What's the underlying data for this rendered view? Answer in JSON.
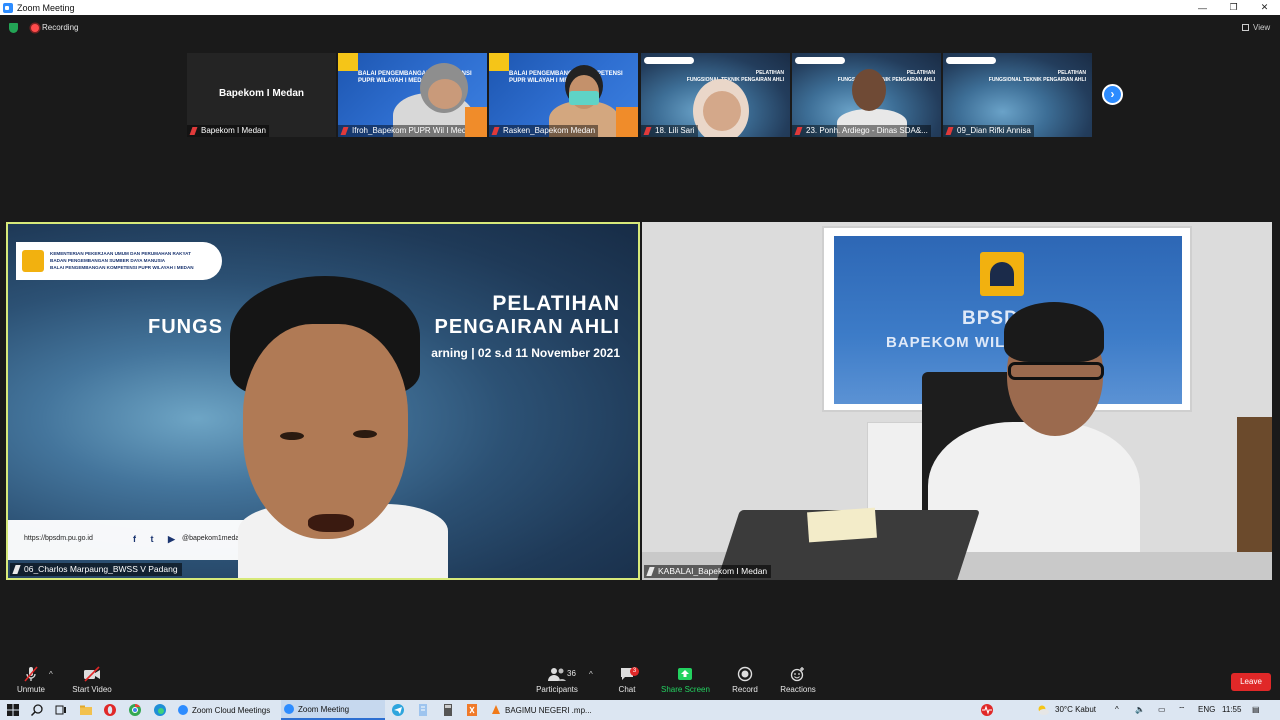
{
  "window": {
    "title": "Zoom Meeting",
    "controls": {
      "minimize": "—",
      "restore": "❐",
      "close": "✕"
    }
  },
  "topbar": {
    "recording_label": "Recording",
    "view_label": "View"
  },
  "thumbnails": [
    {
      "name": "Bapekom I Medan",
      "display_name": "Bapekom I Medan"
    },
    {
      "name": "Ifroh_Bapekom PUPR Wil I Medan"
    },
    {
      "name": "Rasken_Bapekom Medan"
    },
    {
      "name": "18. Lili Sari"
    },
    {
      "name": "23. Ponh. Ardiego - Dinas SDA&..."
    },
    {
      "name": "09_Dian Rifki Annisa"
    }
  ],
  "thumb_banners": {
    "balai": "BALAI PENGEMBANGAN KOMPETENSI",
    "pupr": "PUPR WILAYAH I MEDAN",
    "pelatihan": "PELATIHAN",
    "fungsional": "FUNGSIONAL TEKNIK PENGAIRAN AHLI",
    "dates": "e-Learning | 02 s.d 11 November 2021"
  },
  "main_left": {
    "name": "06_Charlos Marpaung_BWSS V Padang",
    "inst_lines": [
      "KEMENTERIAN PEKERJAAN UMUM DAN PERUMAHAN RAKYAT",
      "BADAN PENGEMBANGAN SUMBER DAYA MANUSIA",
      "BALAI PENGEMBANGAN KOMPETENSI PUPR WILAYAH I MEDAN"
    ],
    "slide_title": "PELATIHAN",
    "slide_title2a": "FUNGS",
    "slide_title2b": "PENGAIRAN AHLI",
    "slide_sub": "arning  |  02 s.d 11 November 2021",
    "footer_url": "https://bpsdm.pu.go.id",
    "footer_social": "f t ▶",
    "footer_handle": "@bapekom1meda"
  },
  "main_right": {
    "name": "KABALAI_Bapekom I Medan",
    "board_line1": "BPSDM",
    "board_line2": "BAPEKOM WIL        AN"
  },
  "toolbar": {
    "unmute": "Unmute",
    "start_video": "Start Video",
    "participants": "Participants",
    "participants_count": "36",
    "chat": "Chat",
    "chat_badge": "3",
    "share_screen": "Share Screen",
    "record": "Record",
    "reactions": "Reactions",
    "leave": "Leave"
  },
  "taskbar": {
    "apps": [
      {
        "label": "Zoom Cloud Meetings"
      },
      {
        "label": "Zoom Meeting"
      },
      {
        "label": "BAGIMU NEGERI .mp..."
      }
    ],
    "weather": "30°C  Kabut",
    "lang": "ENG",
    "time": "11:55"
  },
  "colors": {
    "accent": "#2d8cff",
    "active_speaker_border": "#d7e97a",
    "leave": "#e02828",
    "share": "#23d160"
  }
}
